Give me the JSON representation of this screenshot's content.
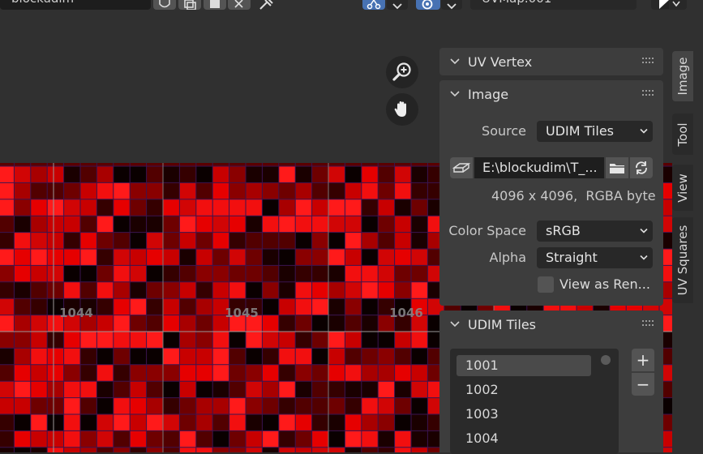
{
  "header": {
    "image_name": "blockudim",
    "uv_map": "UVMap.001"
  },
  "canvas": {
    "tile_labels": [
      "1044",
      "1045",
      "1046"
    ]
  },
  "colors": {
    "panel_bg": "#3d3d3d",
    "field_bg": "#282828",
    "accent_blue": "#4772b3",
    "tile_red": "#e50000"
  },
  "sidebar": {
    "tabs": [
      {
        "label": "Image",
        "active": true
      },
      {
        "label": "Tool",
        "active": false
      },
      {
        "label": "View",
        "active": false
      },
      {
        "label": "UV Squares",
        "active": false
      }
    ],
    "uv_vertex_panel": {
      "title": "UV Vertex"
    },
    "image_panel": {
      "title": "Image",
      "source_label": "Source",
      "source_value": "UDIM Tiles",
      "filepath": "E:\\blockudim\\T_...",
      "info": "4096 x 4096,  RGBA byte",
      "color_space_label": "Color Space",
      "color_space_value": "sRGB",
      "alpha_label": "Alpha",
      "alpha_value": "Straight",
      "view_as_render_label": "View as Ren...",
      "view_as_render_checked": false
    },
    "udim_panel": {
      "title": "UDIM Tiles",
      "tiles": [
        "1001",
        "1002",
        "1003",
        "1004"
      ],
      "selected": "1001",
      "add_label": "+",
      "remove_label": "−"
    }
  }
}
